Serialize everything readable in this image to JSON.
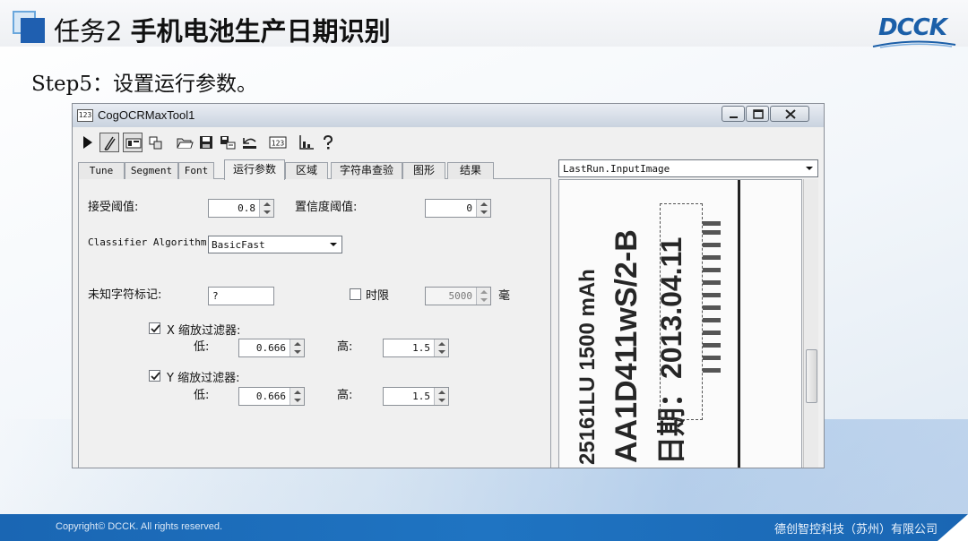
{
  "slide": {
    "title_prefix": "任务2 ",
    "title_main": "手机电池生产日期识别",
    "logo": "DCCK",
    "step_text": "Step5：设置运行参数。",
    "footer_left": "Copyright© DCCK. All rights reserved.",
    "footer_right": "德创智控科技（苏州）有限公司"
  },
  "window": {
    "icon_text": "123",
    "title": "CogOCRMaxTool1"
  },
  "toolbar": {
    "buttons": [
      "run-icon",
      "electric-icon",
      "display-icon",
      "copy-icon",
      "open-folder-icon",
      "save-icon",
      "save-settings-icon",
      "reset-icon",
      "number-icon",
      "chart-icon",
      "help-icon"
    ],
    "number_icon_text": "123"
  },
  "tabs": [
    "Tune",
    "Segment",
    "Font",
    "运行参数",
    "区域",
    "字符串查验",
    "图形",
    "结果"
  ],
  "params": {
    "accept_threshold_label": "接受阈值:",
    "accept_threshold_value": "0.8",
    "confidence_threshold_label": "置信度阈值:",
    "confidence_threshold_value": "0",
    "classifier_label": "Classifier Algorithm:",
    "classifier_value": "BasicFast",
    "unknown_char_label": "未知字符标记:",
    "unknown_char_value": "?",
    "timeout_label": "时限",
    "timeout_checked": false,
    "timeout_value": "5000",
    "timeout_unit": "毫",
    "x_filter_label": "X 缩放过滤器:",
    "x_filter_checked": true,
    "x_low_label": "低:",
    "x_low_value": "0.666",
    "x_high_label": "高:",
    "x_high_value": "1.5",
    "y_filter_label": "Y 缩放过滤器:",
    "y_filter_checked": true,
    "y_low_label": "低:",
    "y_low_value": "0.666",
    "y_high_label": "高:",
    "y_high_value": "1.5"
  },
  "image_panel": {
    "source": "LastRun.InputImage",
    "label_lines": [
      "25161LU    1500 mAh",
      "AA1D411wS/2-B",
      "日期：2013.04.11"
    ]
  },
  "colors": {
    "brand_blue": "#1f5fb0",
    "footer_blue": "#1a66b3",
    "window_bg": "#f0f0f0"
  }
}
